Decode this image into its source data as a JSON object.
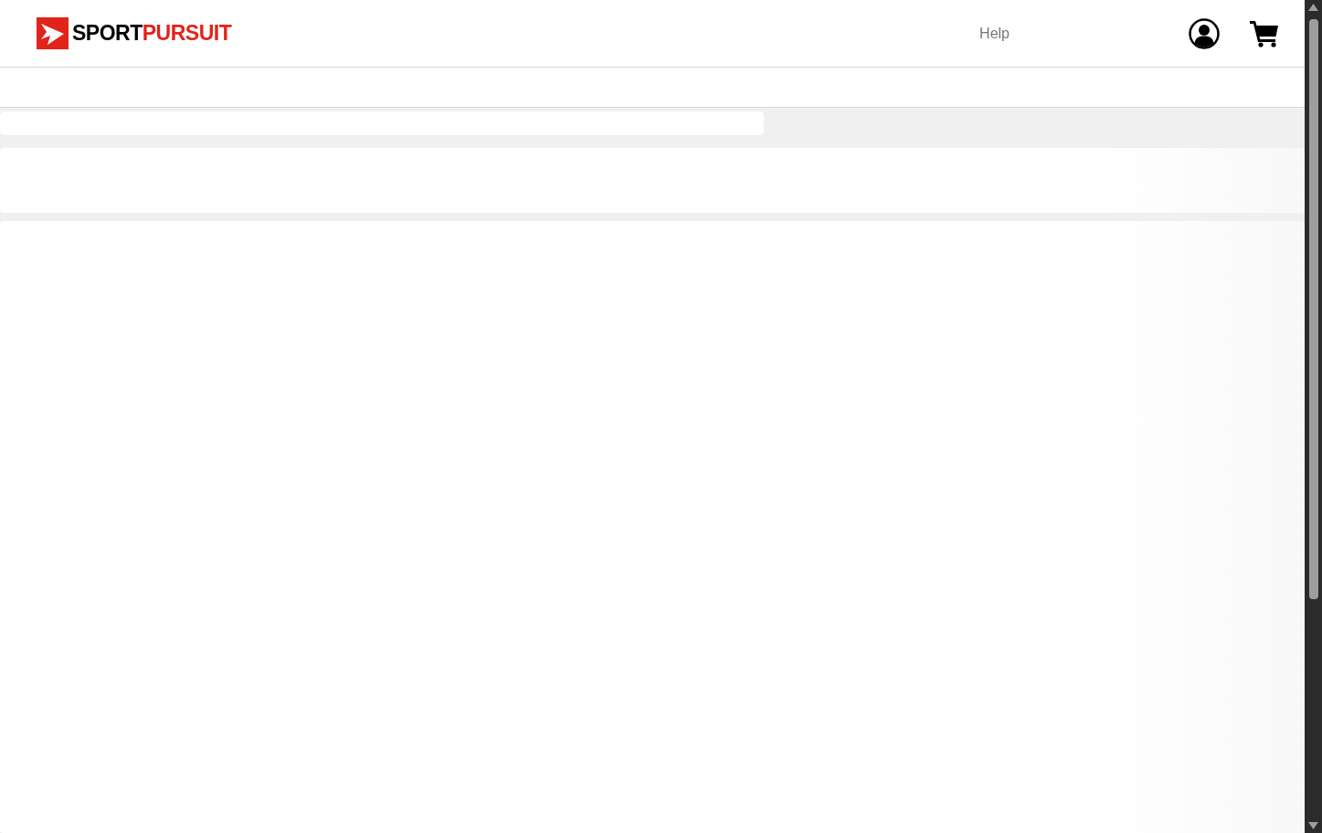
{
  "header": {
    "logo": {
      "text_dark": "SPORT",
      "text_accent": "PURSUIT"
    },
    "links": [
      {
        "label": "Help"
      }
    ]
  },
  "content": {
    "loading": true
  }
}
